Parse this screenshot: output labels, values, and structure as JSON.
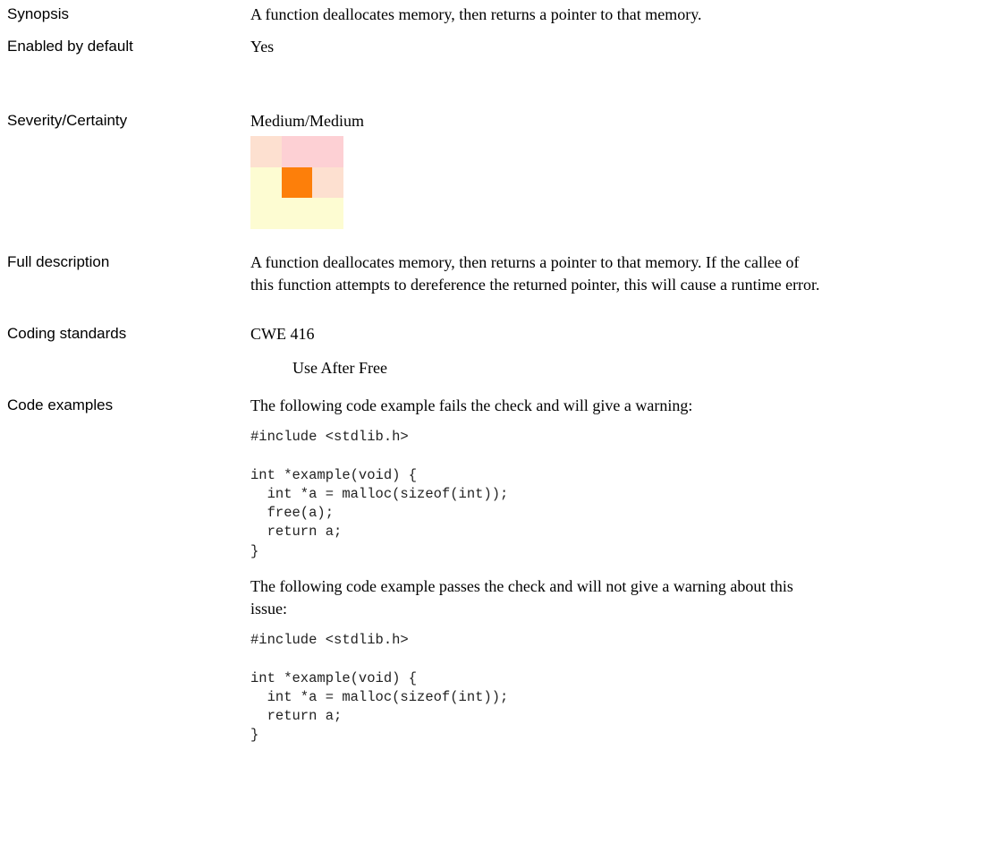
{
  "rows": {
    "synopsis": {
      "label": "Synopsis",
      "value": "A function deallocates memory, then returns a pointer to that memory."
    },
    "enabled": {
      "label": "Enabled by default",
      "value": "Yes"
    },
    "severity": {
      "label": "Severity/Certainty",
      "value": "Medium/Medium",
      "matrix_colors": [
        [
          "#fde0d0",
          "#fdd0d4",
          "#fdd0d4"
        ],
        [
          "#fdfcd2",
          "#fd7f0a",
          "#fde0d0"
        ],
        [
          "#fdfcd2",
          "#fdfcd2",
          "#fdfcd2"
        ]
      ]
    },
    "full_description": {
      "label": "Full description",
      "line1": "A function deallocates memory, then returns a pointer to that memory. If the callee of",
      "line2": "this function attempts to dereference the returned pointer, this will cause a runtime error."
    },
    "coding_standards": {
      "label": "Coding standards",
      "value": "CWE 416",
      "sub": "Use After Free"
    },
    "code_examples": {
      "label": "Code examples",
      "fail_intro": "The following code example fails the check and will give a warning:",
      "fail_code": "#include <stdlib.h>\n\nint *example(void) {\n  int *a = malloc(sizeof(int));\n  free(a);\n  return a;\n}",
      "pass_intro_line1": "The following code example passes the check and will not give a warning about this",
      "pass_intro_line2": "issue:",
      "pass_code": "#include <stdlib.h>\n\nint *example(void) {\n  int *a = malloc(sizeof(int));\n  return a;\n}"
    }
  }
}
